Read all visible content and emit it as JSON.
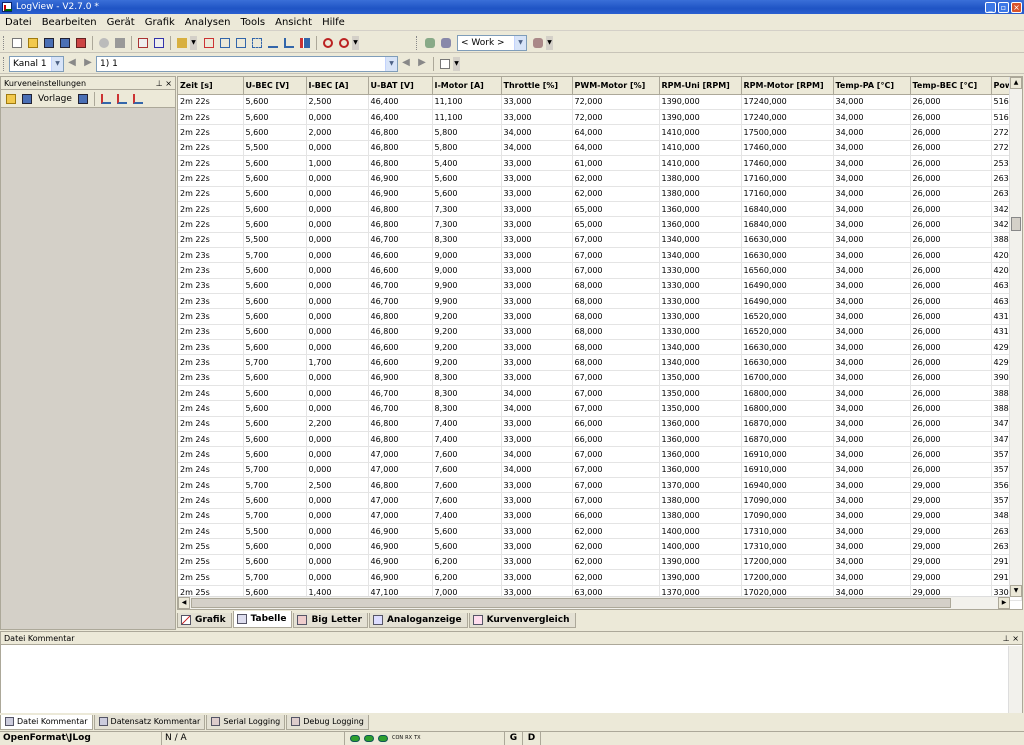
{
  "window": {
    "title": "LogView - V2.7.0 *",
    "minimize": "_",
    "maximize": "▫",
    "close": "×"
  },
  "menu": [
    "Datei",
    "Bearbeiten",
    "Gerät",
    "Grafik",
    "Analysen",
    "Tools",
    "Ansicht",
    "Hilfe"
  ],
  "toolbar": {
    "work_combo": "< Work >"
  },
  "channel": {
    "kanal": "Kanal 1",
    "record": "1) 1"
  },
  "panel": {
    "title": "Kurveneinstellungen",
    "pin": "⊥",
    "close": "×",
    "vorlage": "Vorlage"
  },
  "table": {
    "columns": [
      "Zeit [s]",
      "U-BEC [V]",
      "I-BEC [A]",
      "U-BAT [V]",
      "I-Motor [A]",
      "Throttle [%]",
      "PWM-Motor [%]",
      "RPM-Uni [RPM]",
      "RPM-Motor [RPM]",
      "Temp-PA [°C]",
      "Temp-BEC [°C]",
      "Pow"
    ],
    "rows": [
      [
        "2m 22s",
        "5,600",
        "2,500",
        "46,400",
        "11,100",
        "33,000",
        "72,000",
        "1390,000",
        "17240,000",
        "34,000",
        "26,000",
        "516"
      ],
      [
        "2m 22s",
        "5,600",
        "0,000",
        "46,400",
        "11,100",
        "33,000",
        "72,000",
        "1390,000",
        "17240,000",
        "34,000",
        "26,000",
        "516"
      ],
      [
        "2m 22s",
        "5,600",
        "2,000",
        "46,800",
        "5,800",
        "34,000",
        "64,000",
        "1410,000",
        "17500,000",
        "34,000",
        "26,000",
        "272"
      ],
      [
        "2m 22s",
        "5,500",
        "0,000",
        "46,800",
        "5,800",
        "34,000",
        "64,000",
        "1410,000",
        "17460,000",
        "34,000",
        "26,000",
        "272"
      ],
      [
        "2m 22s",
        "5,600",
        "1,000",
        "46,800",
        "5,400",
        "33,000",
        "61,000",
        "1410,000",
        "17460,000",
        "34,000",
        "26,000",
        "253"
      ],
      [
        "2m 22s",
        "5,600",
        "0,000",
        "46,900",
        "5,600",
        "33,000",
        "62,000",
        "1380,000",
        "17160,000",
        "34,000",
        "26,000",
        "263"
      ],
      [
        "2m 22s",
        "5,600",
        "0,000",
        "46,900",
        "5,600",
        "33,000",
        "62,000",
        "1380,000",
        "17160,000",
        "34,000",
        "26,000",
        "263"
      ],
      [
        "2m 22s",
        "5,600",
        "0,000",
        "46,800",
        "7,300",
        "33,000",
        "65,000",
        "1360,000",
        "16840,000",
        "34,000",
        "26,000",
        "342"
      ],
      [
        "2m 22s",
        "5,600",
        "0,000",
        "46,800",
        "7,300",
        "33,000",
        "65,000",
        "1360,000",
        "16840,000",
        "34,000",
        "26,000",
        "342"
      ],
      [
        "2m 22s",
        "5,500",
        "0,000",
        "46,700",
        "8,300",
        "33,000",
        "67,000",
        "1340,000",
        "16630,000",
        "34,000",
        "26,000",
        "388"
      ],
      [
        "2m 23s",
        "5,700",
        "0,000",
        "46,600",
        "9,000",
        "33,000",
        "67,000",
        "1340,000",
        "16630,000",
        "34,000",
        "26,000",
        "420"
      ],
      [
        "2m 23s",
        "5,600",
        "0,000",
        "46,600",
        "9,000",
        "33,000",
        "67,000",
        "1330,000",
        "16560,000",
        "34,000",
        "26,000",
        "420"
      ],
      [
        "2m 23s",
        "5,600",
        "0,000",
        "46,700",
        "9,900",
        "33,000",
        "68,000",
        "1330,000",
        "16490,000",
        "34,000",
        "26,000",
        "463"
      ],
      [
        "2m 23s",
        "5,600",
        "0,000",
        "46,700",
        "9,900",
        "33,000",
        "68,000",
        "1330,000",
        "16490,000",
        "34,000",
        "26,000",
        "463"
      ],
      [
        "2m 23s",
        "5,600",
        "0,000",
        "46,800",
        "9,200",
        "33,000",
        "68,000",
        "1330,000",
        "16520,000",
        "34,000",
        "26,000",
        "431"
      ],
      [
        "2m 23s",
        "5,600",
        "0,000",
        "46,800",
        "9,200",
        "33,000",
        "68,000",
        "1330,000",
        "16520,000",
        "34,000",
        "26,000",
        "431"
      ],
      [
        "2m 23s",
        "5,600",
        "0,000",
        "46,600",
        "9,200",
        "33,000",
        "68,000",
        "1340,000",
        "16630,000",
        "34,000",
        "26,000",
        "429"
      ],
      [
        "2m 23s",
        "5,700",
        "1,700",
        "46,600",
        "9,200",
        "33,000",
        "68,000",
        "1340,000",
        "16630,000",
        "34,000",
        "26,000",
        "429"
      ],
      [
        "2m 23s",
        "5,600",
        "0,000",
        "46,900",
        "8,300",
        "33,000",
        "67,000",
        "1350,000",
        "16700,000",
        "34,000",
        "26,000",
        "390"
      ],
      [
        "2m 24s",
        "5,600",
        "0,000",
        "46,700",
        "8,300",
        "34,000",
        "67,000",
        "1350,000",
        "16800,000",
        "34,000",
        "26,000",
        "388"
      ],
      [
        "2m 24s",
        "5,600",
        "0,000",
        "46,700",
        "8,300",
        "34,000",
        "67,000",
        "1350,000",
        "16800,000",
        "34,000",
        "26,000",
        "388"
      ],
      [
        "2m 24s",
        "5,600",
        "2,200",
        "46,800",
        "7,400",
        "33,000",
        "66,000",
        "1360,000",
        "16870,000",
        "34,000",
        "26,000",
        "347"
      ],
      [
        "2m 24s",
        "5,600",
        "0,000",
        "46,800",
        "7,400",
        "33,000",
        "66,000",
        "1360,000",
        "16870,000",
        "34,000",
        "26,000",
        "347"
      ],
      [
        "2m 24s",
        "5,600",
        "0,000",
        "47,000",
        "7,600",
        "34,000",
        "67,000",
        "1360,000",
        "16910,000",
        "34,000",
        "26,000",
        "357"
      ],
      [
        "2m 24s",
        "5,700",
        "0,000",
        "47,000",
        "7,600",
        "34,000",
        "67,000",
        "1360,000",
        "16910,000",
        "34,000",
        "26,000",
        "357"
      ],
      [
        "2m 24s",
        "5,700",
        "2,500",
        "46,800",
        "7,600",
        "33,000",
        "67,000",
        "1370,000",
        "16940,000",
        "34,000",
        "29,000",
        "356"
      ],
      [
        "2m 24s",
        "5,600",
        "0,000",
        "47,000",
        "7,600",
        "33,000",
        "67,000",
        "1380,000",
        "17090,000",
        "34,000",
        "29,000",
        "357"
      ],
      [
        "2m 24s",
        "5,700",
        "0,000",
        "47,000",
        "7,400",
        "33,000",
        "66,000",
        "1380,000",
        "17090,000",
        "34,000",
        "29,000",
        "348"
      ],
      [
        "2m 24s",
        "5,500",
        "0,000",
        "46,900",
        "5,600",
        "33,000",
        "62,000",
        "1400,000",
        "17310,000",
        "34,000",
        "29,000",
        "263"
      ],
      [
        "2m 25s",
        "5,600",
        "0,000",
        "46,900",
        "5,600",
        "33,000",
        "62,000",
        "1400,000",
        "17310,000",
        "34,000",
        "29,000",
        "263"
      ],
      [
        "2m 25s",
        "5,600",
        "0,000",
        "46,900",
        "6,200",
        "33,000",
        "62,000",
        "1390,000",
        "17200,000",
        "34,000",
        "29,000",
        "291"
      ],
      [
        "2m 25s",
        "5,700",
        "0,000",
        "46,900",
        "6,200",
        "33,000",
        "62,000",
        "1390,000",
        "17200,000",
        "34,000",
        "29,000",
        "291"
      ],
      [
        "2m 25s",
        "5,600",
        "1,400",
        "47,100",
        "7,000",
        "33,000",
        "63,000",
        "1370,000",
        "17020,000",
        "34,000",
        "29,000",
        "330"
      ]
    ]
  },
  "tabs": [
    "Grafik",
    "Tabelle",
    "Big Letter",
    "Analoganzeige",
    "Kurvenvergleich"
  ],
  "comment": {
    "title": "Datei Kommentar",
    "pin": "⊥",
    "close": "×"
  },
  "bottom_tabs": [
    "Datei Kommentar",
    "Datensatz Kommentar",
    "Serial Logging",
    "Debug Logging"
  ],
  "status": {
    "format": "OpenFormat\\JLog",
    "na": "N / A",
    "leds": [
      "CON",
      "RX",
      "TX"
    ],
    "g": "G",
    "d": "D"
  }
}
